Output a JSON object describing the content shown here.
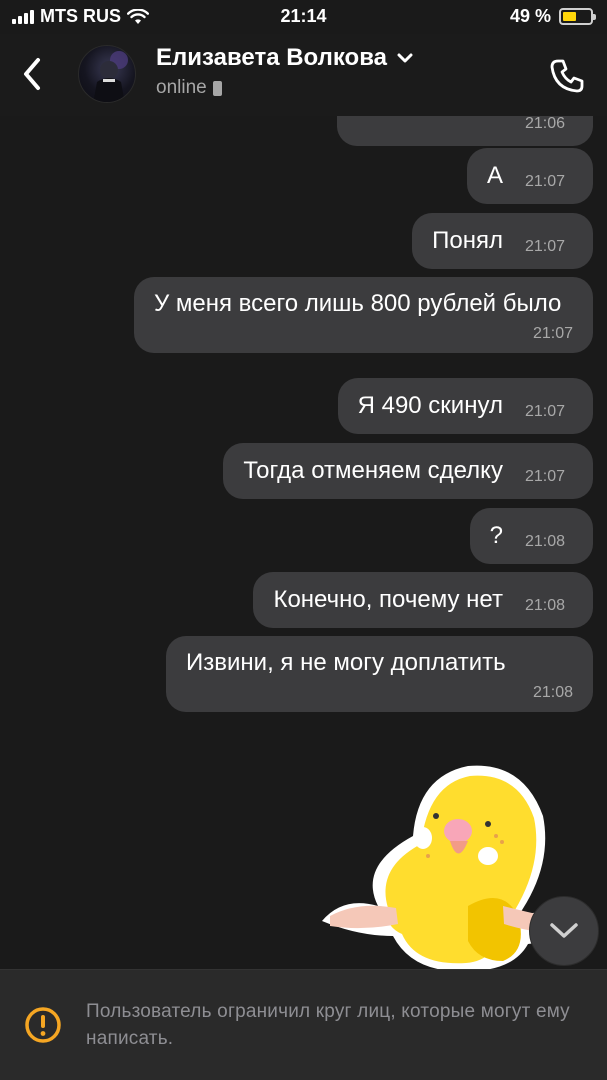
{
  "status_bar": {
    "carrier": "MTS RUS",
    "time": "21:14",
    "battery_percent": "49 %",
    "battery_level": 0.49
  },
  "header": {
    "contact_name": "Елизавета Волкова",
    "status": "online"
  },
  "messages": [
    {
      "text": "",
      "time": "21:06"
    },
    {
      "text": "А",
      "time": "21:07"
    },
    {
      "text": "Понял",
      "time": "21:07"
    },
    {
      "text": "У меня всего лишь 800 рублей было",
      "time": "21:07"
    },
    {
      "text": "Я 490 скинул",
      "time": "21:07"
    },
    {
      "text": "Тогда отменяем сделку",
      "time": "21:07"
    },
    {
      "text": "?",
      "time": "21:08"
    },
    {
      "text": "Конечно, почему нет",
      "time": "21:08"
    },
    {
      "text": "Извини, я не могу доплатить",
      "time": "21:08"
    }
  ],
  "footer": {
    "notice": "Пользователь ограничил круг лиц, которые могут ему написать."
  },
  "colors": {
    "background": "#1a1a1a",
    "bubble": "#3c3c3e",
    "accent_battery": "#ffd60a",
    "warning": "#f5a623"
  }
}
